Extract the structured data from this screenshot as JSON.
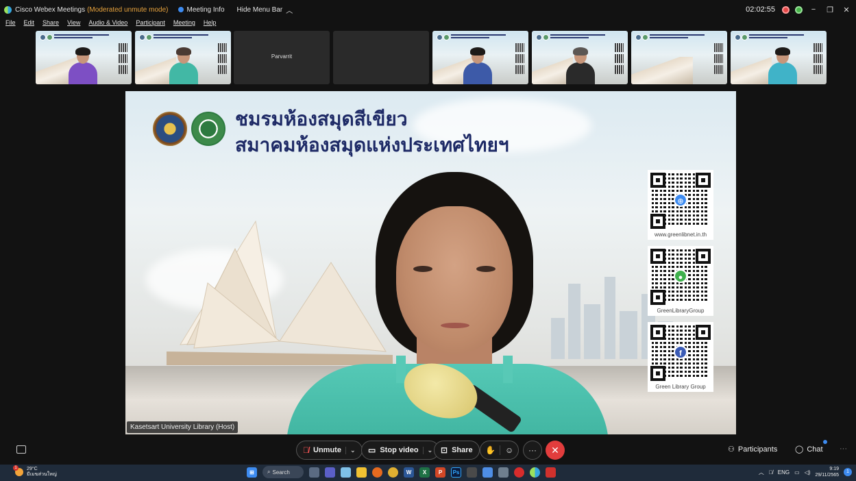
{
  "titlebar": {
    "app_name": "Cisco Webex Meetings",
    "mode": "(Moderated unmute mode)",
    "meeting_info": "Meeting Info",
    "hide_menu": "Hide Menu Bar",
    "hide_icon": "chevron-up-icon",
    "timer": "02:02:55",
    "min": "−",
    "max": "❐",
    "close": "✕"
  },
  "menu": [
    "File",
    "Edit",
    "Share",
    "View",
    "Audio & Video",
    "Participant",
    "Meeting",
    "Help"
  ],
  "thumbnails": {
    "t3_name": "Parvarrit"
  },
  "slide": {
    "title_line1": "ชมรมห้องสมุดสีเขียว",
    "title_line2": "สมาคมห้องสมุดแห่งประเทศไทยฯ",
    "qr": [
      {
        "label": "www.greenlibnet.in.th",
        "icon": "globe-icon",
        "color": "#3d8bf0"
      },
      {
        "label": "GreenLibraryGroup",
        "icon": "line-icon",
        "color": "#3fb14d"
      },
      {
        "label": "Green Library Group",
        "icon": "facebook-icon",
        "color": "#3b5bb5"
      }
    ]
  },
  "host_label": "Kasetsart University Library (Host)",
  "controls": {
    "unmute": "Unmute",
    "stop_video": "Stop video",
    "share": "Share",
    "participants": "Participants",
    "chat": "Chat",
    "more": "···",
    "end": "✕"
  },
  "taskbar": {
    "temp": "29°C",
    "weather_text": "มีเมฆส่วนใหญ่",
    "search": "Search",
    "lang": "ENG",
    "time": "9:19",
    "date": "29/11/2565",
    "notif": "1"
  }
}
